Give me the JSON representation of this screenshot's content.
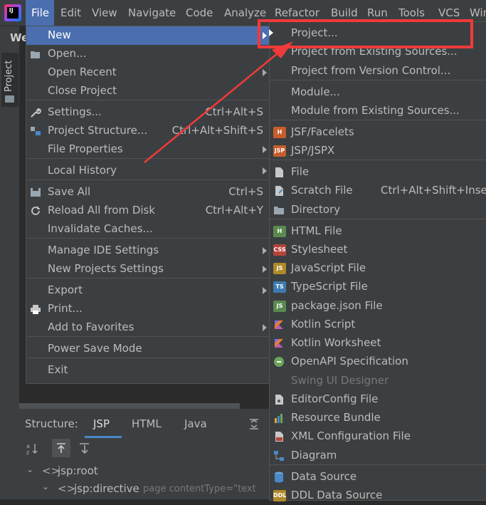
{
  "menubar": {
    "items": [
      "File",
      "Edit",
      "View",
      "Navigate",
      "Code",
      "Analyze",
      "Refactor",
      "Build",
      "Run",
      "Tools",
      "VCS",
      "Win"
    ]
  },
  "project_tab_label": "Project",
  "window_title_fragment": "We",
  "file_menu": {
    "items": [
      {
        "label": "New",
        "shortcut": "",
        "submenu": true,
        "selected": true,
        "icon": ""
      },
      {
        "label": "Open...",
        "shortcut": "",
        "submenu": false,
        "icon": "folder-open-icon"
      },
      {
        "label": "Open Recent",
        "shortcut": "",
        "submenu": true,
        "icon": ""
      },
      {
        "label": "Close Project",
        "shortcut": "",
        "submenu": false,
        "icon": ""
      },
      {
        "label": "Settings...",
        "shortcut": "Ctrl+Alt+S",
        "submenu": false,
        "icon": "wrench-icon"
      },
      {
        "label": "Project Structure...",
        "shortcut": "Ctrl+Alt+Shift+S",
        "submenu": false,
        "icon": "project-structure-icon"
      },
      {
        "label": "File Properties",
        "shortcut": "",
        "submenu": true,
        "icon": ""
      },
      {
        "label": "Local History",
        "shortcut": "",
        "submenu": true,
        "icon": ""
      },
      {
        "label": "Save All",
        "shortcut": "Ctrl+S",
        "submenu": false,
        "icon": "save-icon"
      },
      {
        "label": "Reload All from Disk",
        "shortcut": "Ctrl+Alt+Y",
        "submenu": false,
        "icon": "reload-icon"
      },
      {
        "label": "Invalidate Caches...",
        "shortcut": "",
        "submenu": false,
        "icon": ""
      },
      {
        "label": "Manage IDE Settings",
        "shortcut": "",
        "submenu": true,
        "icon": ""
      },
      {
        "label": "New Projects Settings",
        "shortcut": "",
        "submenu": true,
        "icon": ""
      },
      {
        "label": "Export",
        "shortcut": "",
        "submenu": true,
        "icon": ""
      },
      {
        "label": "Print...",
        "shortcut": "",
        "submenu": false,
        "icon": "print-icon"
      },
      {
        "label": "Add to Favorites",
        "shortcut": "",
        "submenu": true,
        "icon": ""
      },
      {
        "label": "Power Save Mode",
        "shortcut": "",
        "submenu": false,
        "icon": ""
      },
      {
        "label": "Exit",
        "shortcut": "",
        "submenu": false,
        "icon": ""
      }
    ]
  },
  "new_menu": {
    "items": [
      {
        "label": "Project...",
        "shortcut": "",
        "icon": ""
      },
      {
        "label": "Project from Existing Sources...",
        "shortcut": "",
        "icon": ""
      },
      {
        "label": "Project from Version Control...",
        "shortcut": "",
        "icon": ""
      },
      {
        "label": "Module...",
        "shortcut": "",
        "icon": ""
      },
      {
        "label": "Module from Existing Sources...",
        "shortcut": "",
        "icon": ""
      },
      {
        "label": "JSF/Facelets",
        "shortcut": "",
        "icon": "jsf-facelets-icon",
        "icon_text": "H",
        "icon_color": "#c75d2c"
      },
      {
        "label": "JSP/JSPX",
        "shortcut": "",
        "icon": "jsp-icon",
        "icon_text": "JSP",
        "icon_color": "#c75d2c"
      },
      {
        "label": "File",
        "shortcut": "",
        "icon": "file-icon"
      },
      {
        "label": "Scratch File",
        "shortcut": "Ctrl+Alt+Shift+Inser",
        "icon": "scratch-file-icon"
      },
      {
        "label": "Directory",
        "shortcut": "",
        "icon": "directory-icon"
      },
      {
        "label": "HTML File",
        "shortcut": "",
        "icon": "html-file-icon",
        "icon_text": "H",
        "icon_color": "#5a8a4f"
      },
      {
        "label": "Stylesheet",
        "shortcut": "",
        "icon": "css-icon",
        "icon_text": "CSS",
        "icon_color": "#b5443b"
      },
      {
        "label": "JavaScript File",
        "shortcut": "",
        "icon": "javascript-icon",
        "icon_text": "JS",
        "icon_color": "#b08a2a"
      },
      {
        "label": "TypeScript File",
        "shortcut": "",
        "icon": "typescript-icon",
        "icon_text": "TS",
        "icon_color": "#3d7bb0"
      },
      {
        "label": "package.json File",
        "shortcut": "",
        "icon": "nodejs-icon",
        "icon_text": "JS",
        "icon_color": "#5a8a4f"
      },
      {
        "label": "Kotlin Script",
        "shortcut": "",
        "icon": "kotlin-icon"
      },
      {
        "label": "Kotlin Worksheet",
        "shortcut": "",
        "icon": "kotlin-worksheet-icon"
      },
      {
        "label": "OpenAPI Specification",
        "shortcut": "",
        "icon": "openapi-icon"
      },
      {
        "label": "Swing UI Designer",
        "shortcut": "",
        "icon": "",
        "disabled": true
      },
      {
        "label": "EditorConfig File",
        "shortcut": "",
        "icon": "editorconfig-icon"
      },
      {
        "label": "Resource Bundle",
        "shortcut": "",
        "icon": "resource-bundle-icon"
      },
      {
        "label": "XML Configuration File",
        "shortcut": "",
        "icon": "xml-icon"
      },
      {
        "label": "Diagram",
        "shortcut": "",
        "icon": "diagram-icon"
      },
      {
        "label": "Data Source",
        "shortcut": "",
        "icon": "data-source-icon"
      },
      {
        "label": "DDL Data Source",
        "shortcut": "",
        "icon": "ddl-icon",
        "icon_text": "DDL",
        "icon_color": "#b08a2a"
      }
    ]
  },
  "structure_panel": {
    "label": "Structure:",
    "tabs": [
      "JSP",
      "HTML",
      "Java"
    ],
    "active_tab": "JSP",
    "tree": [
      {
        "label": "jsp:root",
        "detail": ""
      },
      {
        "label": "jsp:directive",
        "detail": "page contentType=\"text"
      }
    ]
  },
  "colors": {
    "selection": "#4b6eaf",
    "menu_bg": "#3c3f41",
    "annotation": "#f03a3a"
  }
}
